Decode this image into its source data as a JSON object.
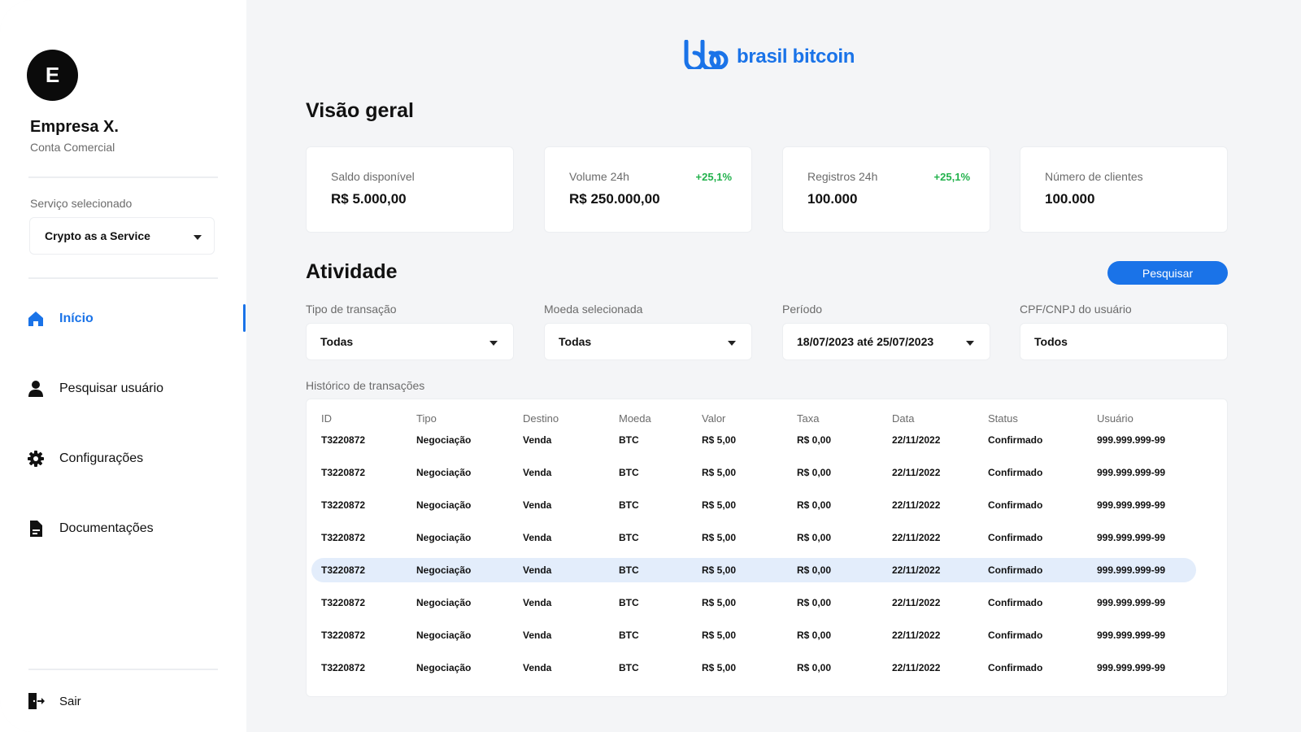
{
  "sidebar": {
    "avatar_letter": "E",
    "company_name": "Empresa X.",
    "account_type": "Conta Comercial",
    "service_label": "Serviço selecionado",
    "service_value": "Crypto as a Service",
    "nav": [
      {
        "label": "Início",
        "icon": "home-icon",
        "active": true
      },
      {
        "label": "Pesquisar usuário",
        "icon": "user-icon",
        "active": false
      },
      {
        "label": "Configurações",
        "icon": "gear-icon",
        "active": false
      },
      {
        "label": "Documentações",
        "icon": "document-icon",
        "active": false
      }
    ],
    "logout_label": "Sair"
  },
  "brand": {
    "name": "brasil bitcoin",
    "color": "#1a73e8"
  },
  "overview": {
    "title": "Visão geral",
    "cards": [
      {
        "label": "Saldo disponível",
        "value": "R$ 5.000,00",
        "change": ""
      },
      {
        "label": "Volume 24h",
        "value": "R$ 250.000,00",
        "change": "+25,1%"
      },
      {
        "label": "Registros 24h",
        "value": "100.000",
        "change": "+25,1%"
      },
      {
        "label": "Número de clientes",
        "value": "100.000",
        "change": ""
      }
    ]
  },
  "activity": {
    "title": "Atividade",
    "search_button": "Pesquisar",
    "filters": [
      {
        "label": "Tipo de transação",
        "value": "Todas",
        "dropdown": true
      },
      {
        "label": "Moeda selecionada",
        "value": "Todas",
        "dropdown": true
      },
      {
        "label": "Período",
        "value": "18/07/2023 até 25/07/2023",
        "dropdown": true
      },
      {
        "label": "CPF/CNPJ do usuário",
        "value": "Todos",
        "dropdown": false
      }
    ],
    "history_label": "Histórico de transações",
    "columns": [
      "ID",
      "Tipo",
      "Destino",
      "Moeda",
      "Valor",
      "Taxa",
      "Data",
      "Status",
      "Usuário"
    ],
    "highlighted_row": 4,
    "rows": [
      [
        "T3220872",
        "Negociação",
        "Venda",
        "BTC",
        "R$ 5,00",
        "R$ 0,00",
        "22/11/2022",
        "Confirmado",
        "999.999.999-99"
      ],
      [
        "T3220872",
        "Negociação",
        "Venda",
        "BTC",
        "R$ 5,00",
        "R$ 0,00",
        "22/11/2022",
        "Confirmado",
        "999.999.999-99"
      ],
      [
        "T3220872",
        "Negociação",
        "Venda",
        "BTC",
        "R$ 5,00",
        "R$ 0,00",
        "22/11/2022",
        "Confirmado",
        "999.999.999-99"
      ],
      [
        "T3220872",
        "Negociação",
        "Venda",
        "BTC",
        "R$ 5,00",
        "R$ 0,00",
        "22/11/2022",
        "Confirmado",
        "999.999.999-99"
      ],
      [
        "T3220872",
        "Negociação",
        "Venda",
        "BTC",
        "R$ 5,00",
        "R$ 0,00",
        "22/11/2022",
        "Confirmado",
        "999.999.999-99"
      ],
      [
        "T3220872",
        "Negociação",
        "Venda",
        "BTC",
        "R$ 5,00",
        "R$ 0,00",
        "22/11/2022",
        "Confirmado",
        "999.999.999-99"
      ],
      [
        "T3220872",
        "Negociação",
        "Venda",
        "BTC",
        "R$ 5,00",
        "R$ 0,00",
        "22/11/2022",
        "Confirmado",
        "999.999.999-99"
      ],
      [
        "T3220872",
        "Negociação",
        "Venda",
        "BTC",
        "R$ 5,00",
        "R$ 0,00",
        "22/11/2022",
        "Confirmado",
        "999.999.999-99"
      ]
    ]
  }
}
